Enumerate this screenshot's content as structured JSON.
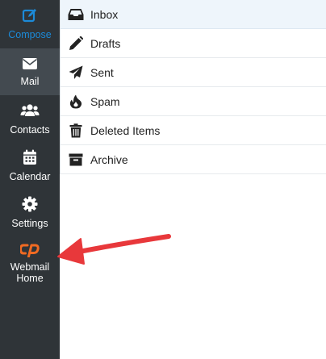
{
  "sidebar": {
    "items": [
      {
        "id": "compose",
        "label": "Compose",
        "icon": "compose-icon",
        "color": "#1c8ad8"
      },
      {
        "id": "mail",
        "label": "Mail",
        "icon": "envelope-icon",
        "active": true
      },
      {
        "id": "contacts",
        "label": "Contacts",
        "icon": "users-icon"
      },
      {
        "id": "calendar",
        "label": "Calendar",
        "icon": "calendar-icon"
      },
      {
        "id": "settings",
        "label": "Settings",
        "icon": "gear-icon"
      },
      {
        "id": "webmail",
        "label_line1": "Webmail",
        "label_line2": "Home",
        "icon": "cpanel-logo-icon",
        "icon_color": "#f06a22"
      }
    ]
  },
  "folders": [
    {
      "label": "Inbox",
      "icon": "inbox-icon",
      "selected": true
    },
    {
      "label": "Drafts",
      "icon": "pencil-icon"
    },
    {
      "label": "Sent",
      "icon": "paper-plane-icon"
    },
    {
      "label": "Spam",
      "icon": "fire-icon"
    },
    {
      "label": "Deleted Items",
      "icon": "trash-icon"
    },
    {
      "label": "Archive",
      "icon": "archive-box-icon"
    }
  ],
  "annotation": {
    "arrow_color": "#e8383b"
  },
  "colors": {
    "sidebar_bg": "#2f3438",
    "sidebar_active": "#434a50",
    "selected_row": "#eef5fb"
  }
}
